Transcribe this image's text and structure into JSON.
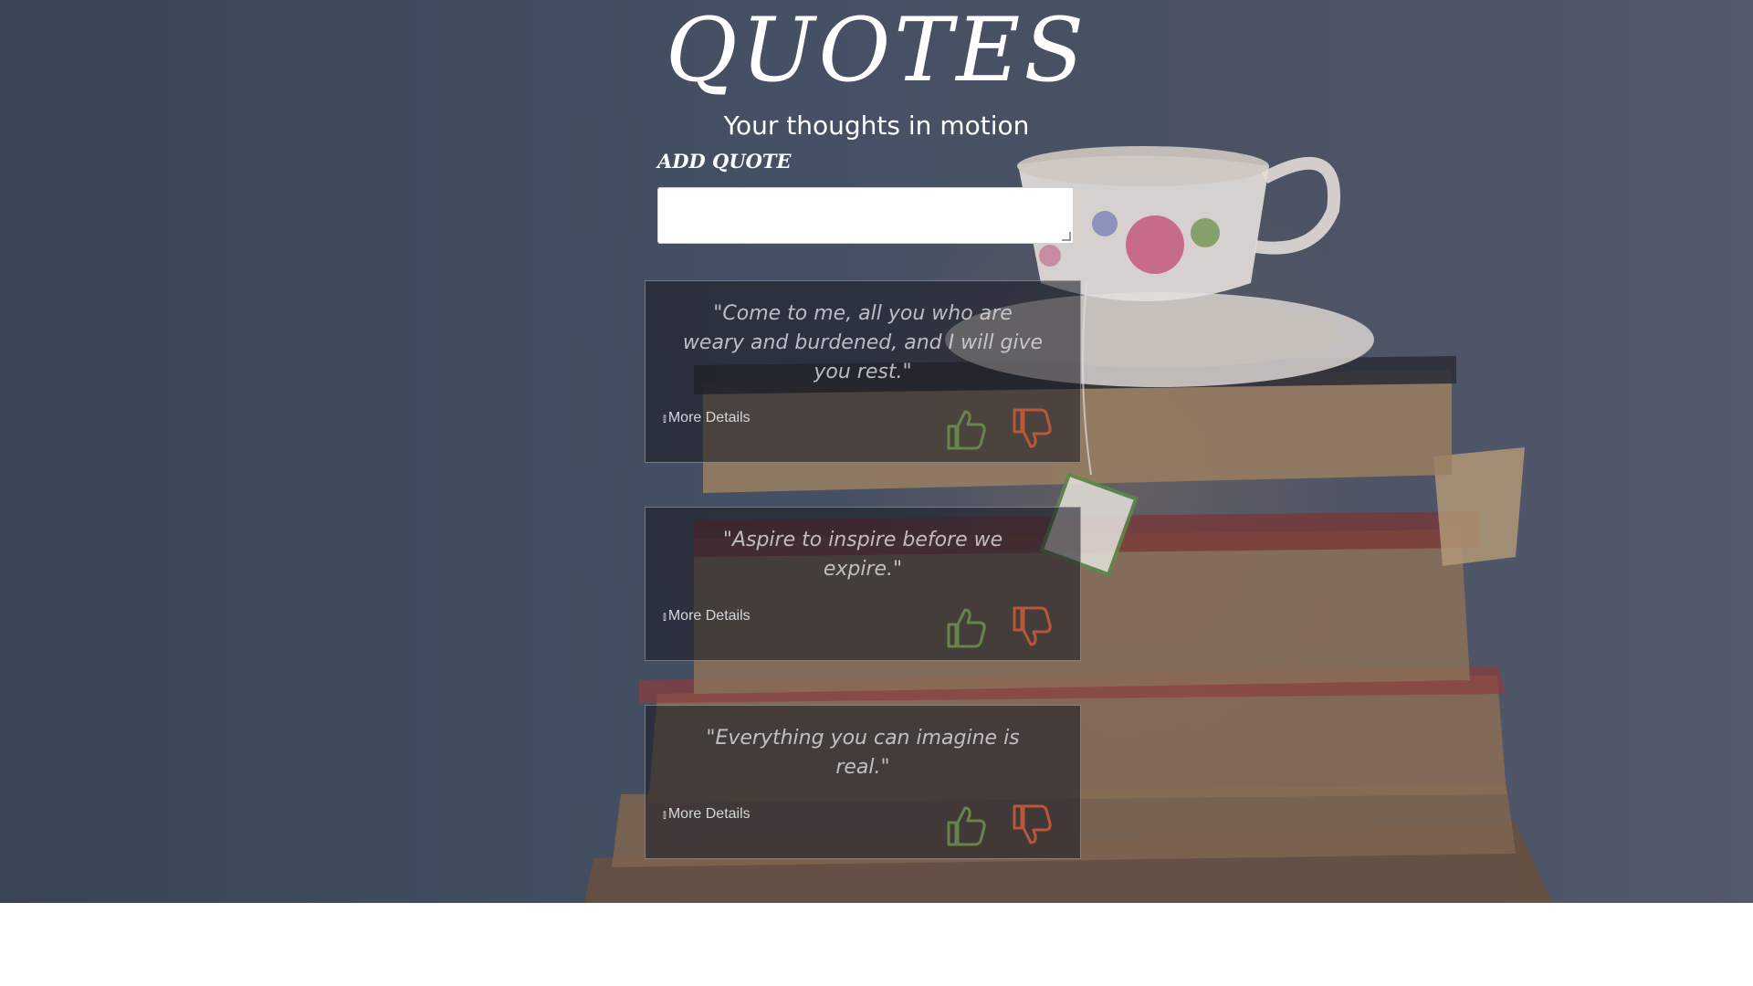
{
  "header": {
    "title": "QUOTES",
    "subtitle": "Your thoughts in motion"
  },
  "form": {
    "add_label": "ADD QUOTE",
    "input_value": "",
    "input_placeholder": ""
  },
  "quotes": [
    {
      "text": "\"Come to me, all you who are weary and burdened, and I will give you rest.\"",
      "details_label": "More Details"
    },
    {
      "text": "\"Aspire to inspire before we expire.\"",
      "details_label": "More Details"
    },
    {
      "text": "\"Everything you can imagine is real.\"",
      "details_label": "More Details"
    }
  ],
  "icons": {
    "like": "thumbs-up-icon",
    "dislike": "thumbs-down-icon",
    "expand": "double-chevron-down-icon"
  },
  "colors": {
    "like": "#6f8f4f",
    "dislike": "#c85a3a",
    "card_bg": "#191b24"
  }
}
